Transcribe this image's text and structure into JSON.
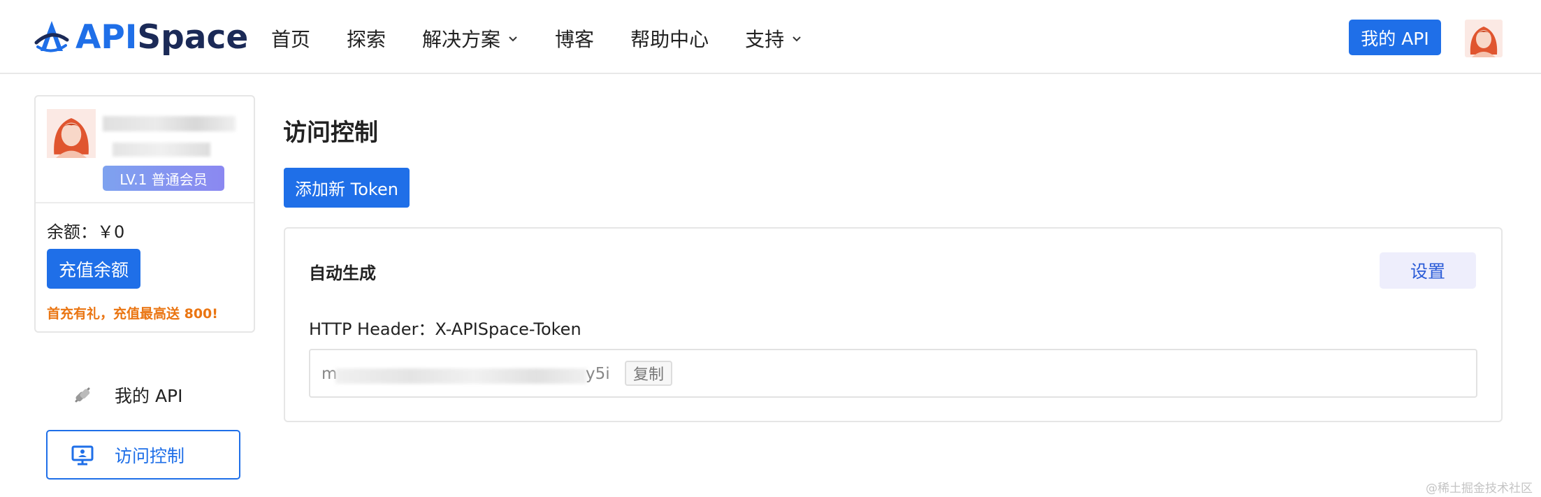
{
  "brand": {
    "logo_api": "API",
    "logo_space": "Space",
    "accent": "#1f6fe8"
  },
  "nav": {
    "items": [
      {
        "label": "首页",
        "has_dropdown": false
      },
      {
        "label": "探索",
        "has_dropdown": false
      },
      {
        "label": "解决方案",
        "has_dropdown": true
      },
      {
        "label": "博客",
        "has_dropdown": false
      },
      {
        "label": "帮助中心",
        "has_dropdown": false
      },
      {
        "label": "支持",
        "has_dropdown": true
      }
    ],
    "my_api_button": "我的 API"
  },
  "user_card": {
    "level_badge": "LV.1 普通会员",
    "balance": "余额：￥0",
    "recharge_button": "充值余额",
    "promo": "首充有礼，充值最高送 800!"
  },
  "side_nav": {
    "my_api": "我的 API",
    "access_control": "访问控制"
  },
  "main": {
    "title": "访问控制",
    "add_token_button": "添加新 Token",
    "card": {
      "title": "自动生成",
      "settings_button": "设置",
      "header_label": "HTTP Header：X-APISpace-Token",
      "token_prefix": "m",
      "token_suffix": "y5i",
      "copy_button": "复制"
    }
  },
  "watermark": "@稀土掘金技术社区"
}
